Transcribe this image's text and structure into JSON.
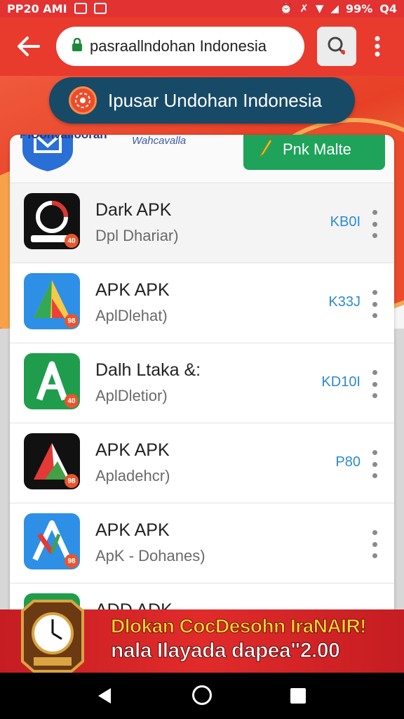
{
  "status_bar": {
    "time": "PP20 AMI",
    "battery_text": "99%",
    "extra_text": "Q4"
  },
  "toolbar": {
    "url": "pasraallndohan Indonesia"
  },
  "title_pill": {
    "text": "Ipusar Undohan Indonesia"
  },
  "card_header": {
    "site_name": "PIUonvalloorah",
    "site_sub": "Wahcavalla",
    "promo_label": "Pnk Malte"
  },
  "apps": [
    {
      "name": "Dark APK",
      "desc": "Dpl Dhariar)",
      "size": "KB0I",
      "icon": "dark-apk-icon",
      "badge": "40"
    },
    {
      "name": "APK APK",
      "desc": "AplDlehat)",
      "size": "K33J",
      "icon": "apk-triangle-icon",
      "badge": "98"
    },
    {
      "name": "Dalh Ltaka &:",
      "desc": "AplDletior)",
      "size": "KD10I",
      "icon": "green-a-icon",
      "badge": "40"
    },
    {
      "name": "APK APK",
      "desc": "Apladehcr)",
      "size": "P80",
      "icon": "black-red-a-icon",
      "badge": "98"
    },
    {
      "name": "APK APK",
      "desc": "ApK - Dohanes)",
      "size": "",
      "icon": "blue-red-a-icon",
      "badge": "98"
    },
    {
      "name": "ADD ADK",
      "desc": "",
      "size": "",
      "icon": "green-partial-icon",
      "badge": ""
    }
  ],
  "ad": {
    "line1": "Dlokan CocDesohn IraNAIR!",
    "line2": "nala Ilayada dapea\"2.00"
  },
  "colors": {
    "accent_red": "#e93a2e",
    "pill_blue": "#174a66",
    "promo_green": "#1fa35a",
    "size_blue": "#2c8bd0"
  }
}
